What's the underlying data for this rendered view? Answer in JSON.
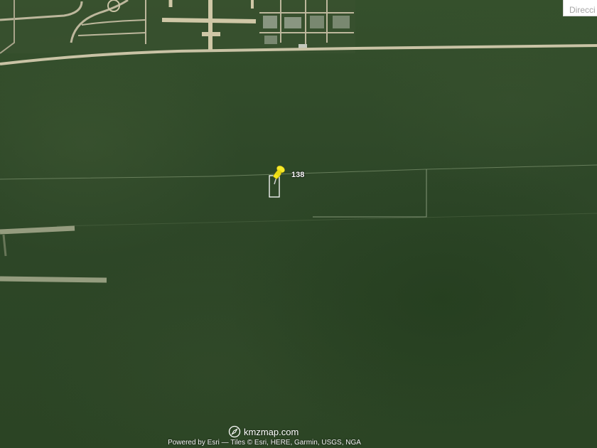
{
  "search": {
    "placeholder": "Direcci"
  },
  "marker": {
    "label": "138",
    "color": "#f5e51c",
    "icon": "pushpin-icon"
  },
  "parcel": {
    "outline_color": "#ffffff"
  },
  "branding": {
    "icon": "compass-icon",
    "text": "kmzmap.com"
  },
  "attribution": {
    "text": "Powered by Esri — Tiles © Esri, HERE, Garmin, USGS, NGA"
  },
  "colors": {
    "vegetation": "#2c4325",
    "road": "#c9c3a5"
  }
}
